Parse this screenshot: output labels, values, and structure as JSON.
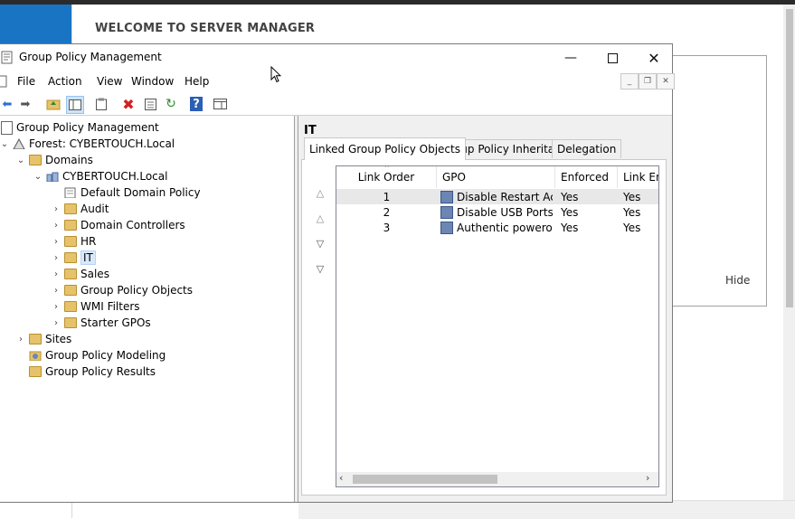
{
  "background": {
    "welcome_text": "WELCOME TO SERVER MANAGER",
    "hide_label": "Hide"
  },
  "window": {
    "title": "Group Policy Management",
    "menu": [
      "File",
      "Action",
      "View",
      "Window",
      "Help"
    ]
  },
  "tree": {
    "root": "Group Policy Management",
    "forest": "Forest: CYBERTOUCH.Local",
    "domains": "Domains",
    "domain": "CYBERTOUCH.Local",
    "items": {
      "default_policy": "Default Domain Policy",
      "audit": "Audit",
      "dc": "Domain Controllers",
      "hr": "HR",
      "it": "IT",
      "sales": "Sales",
      "gpo": "Group Policy Objects",
      "wmi": "WMI Filters",
      "starter": "Starter GPOs"
    },
    "sites": "Sites",
    "modeling": "Group Policy Modeling",
    "results": "Group Policy Results"
  },
  "right_pane": {
    "title": "IT",
    "tabs": [
      "Linked Group Policy Objects",
      "Group Policy Inheritance",
      "Delegation"
    ],
    "columns": [
      "Link Order",
      "GPO",
      "Enforced",
      "Link Ena"
    ],
    "rows": [
      {
        "order": "1",
        "gpo": "Disable Restart Acc...",
        "enforced": "Yes",
        "enabled": "Yes"
      },
      {
        "order": "2",
        "gpo": "Disable USB Ports",
        "enforced": "Yes",
        "enabled": "Yes"
      },
      {
        "order": "3",
        "gpo": "Authentic poweroff ...",
        "enforced": "Yes",
        "enabled": "Yes"
      }
    ]
  },
  "colors": {
    "selection": "#d9e8fb",
    "folder": "#e6c26a",
    "accent_blue": "#1a74c4"
  }
}
